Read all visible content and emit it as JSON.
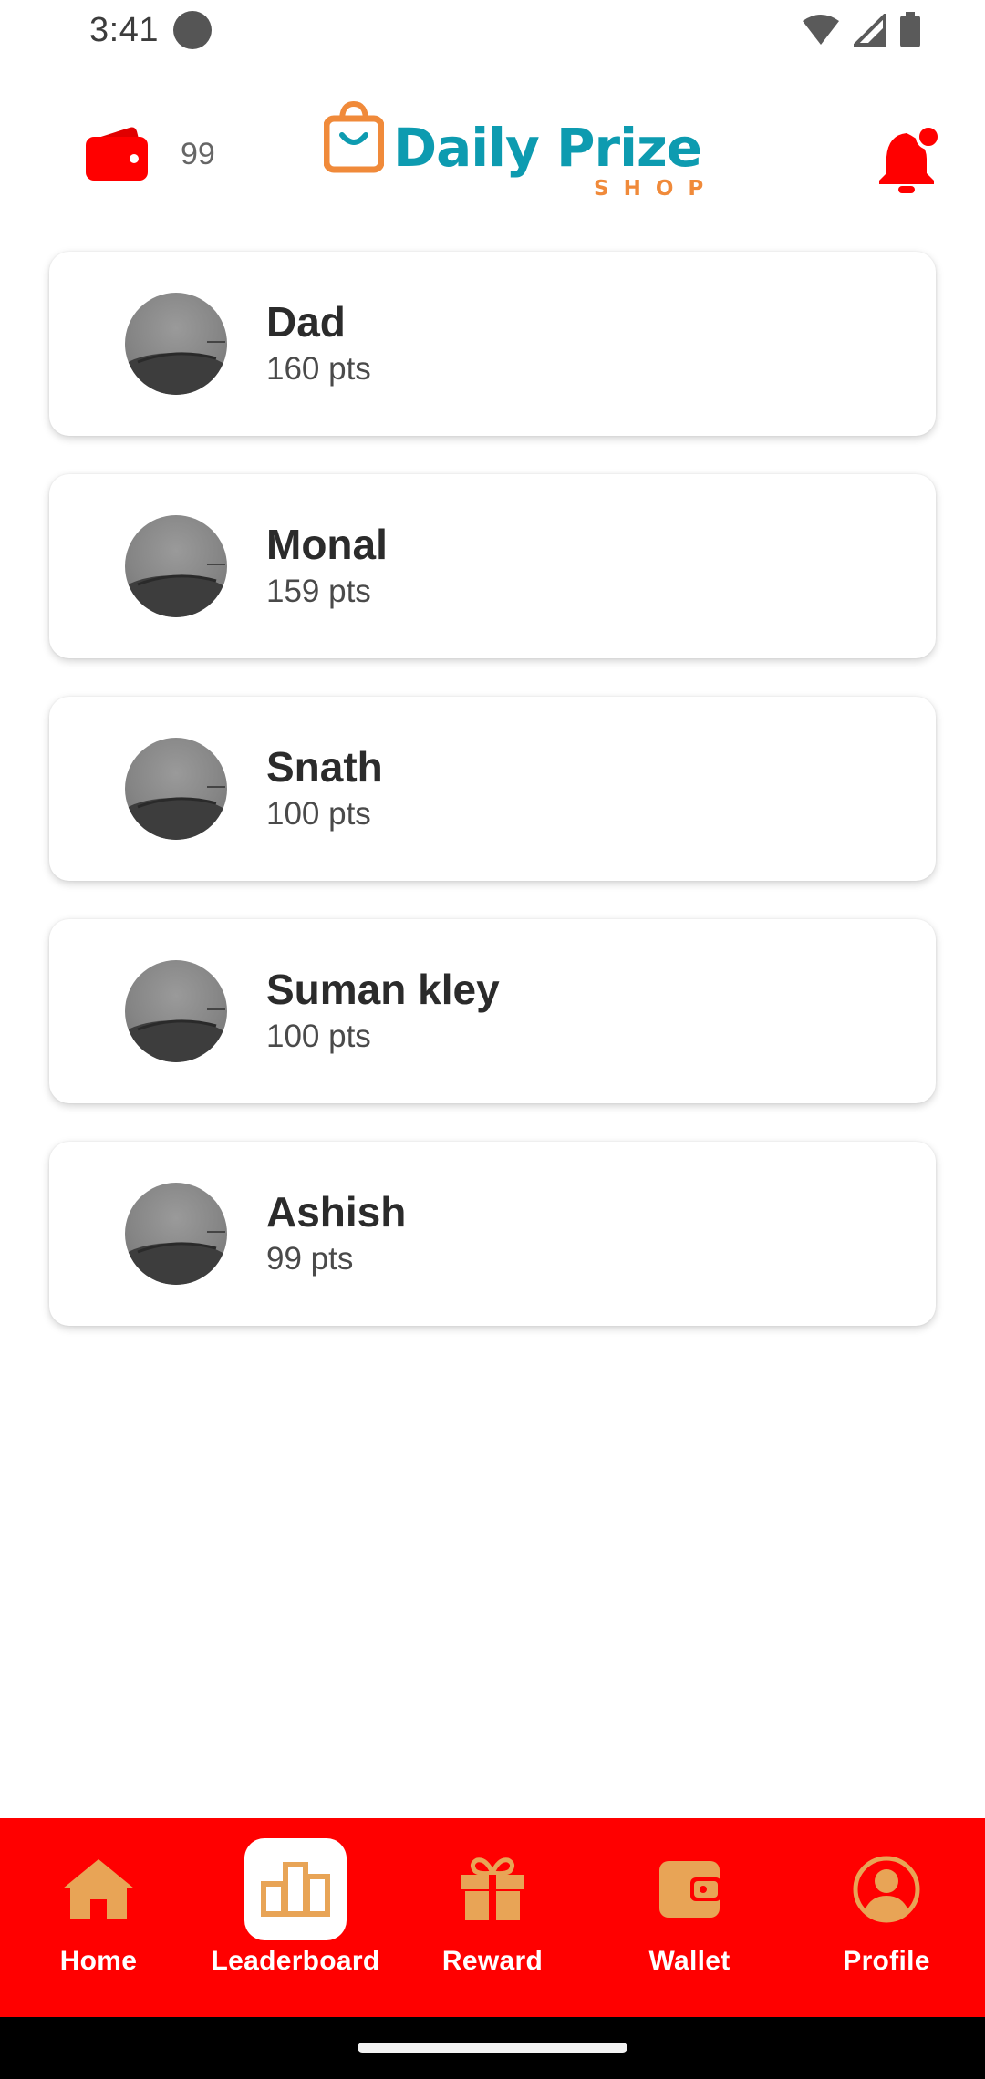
{
  "status_bar": {
    "time": "3:41"
  },
  "header": {
    "wallet_count": "99",
    "logo_main": "Daily Prize",
    "logo_sub": "SHOP"
  },
  "leaderboard": [
    {
      "name": "Dad",
      "points": "160 pts"
    },
    {
      "name": "Monal",
      "points": "159 pts"
    },
    {
      "name": "Snath",
      "points": "100 pts"
    },
    {
      "name": "Suman kley",
      "points": "100 pts"
    },
    {
      "name": "Ashish",
      "points": "99 pts"
    }
  ],
  "nav": {
    "home": "Home",
    "leaderboard": "Leaderboard",
    "reward": "Reward",
    "wallet": "Wallet",
    "profile": "Profile",
    "active": "leaderboard"
  },
  "colors": {
    "brand_red": "#ff0000",
    "nav_icon": "#e8a456",
    "logo_teal": "#0d9bb0",
    "logo_orange": "#f08a3a"
  }
}
